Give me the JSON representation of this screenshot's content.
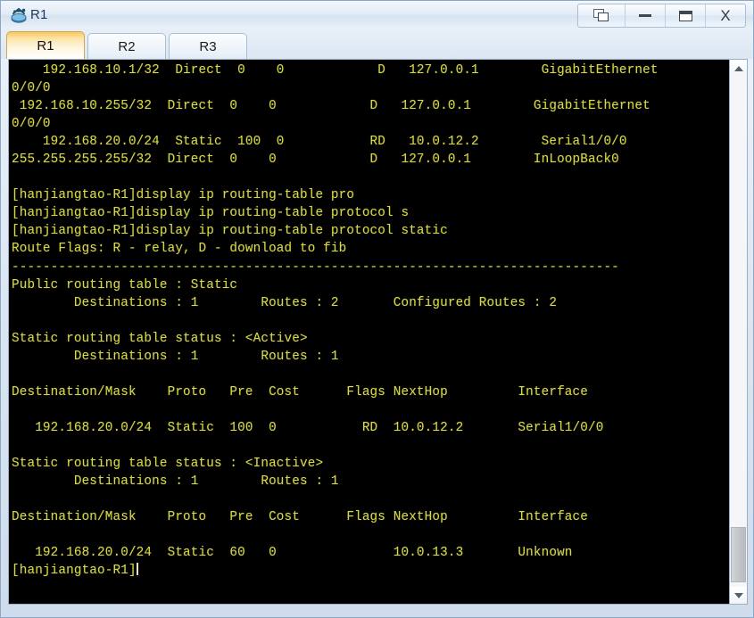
{
  "window": {
    "title": "R1",
    "icon": "router-icon",
    "buttons": [
      {
        "name": "restore-button",
        "label": "Restore",
        "glyph": "restore-icon"
      },
      {
        "name": "minimize-button",
        "label": "Minimize",
        "glyph": "minimize-icon"
      },
      {
        "name": "maximize-button",
        "label": "Maximize",
        "glyph": "maximize-icon"
      },
      {
        "name": "close-button",
        "label": "X",
        "glyph": "close-icon"
      }
    ]
  },
  "tabs": [
    {
      "label": "R1",
      "active": true
    },
    {
      "label": "R2",
      "active": false
    },
    {
      "label": "R3",
      "active": false
    }
  ],
  "terminal": {
    "prompt": "[hanjiangtao-R1]",
    "cursor_visible": true,
    "text_color": "#d7d74a",
    "background_color": "#000000",
    "lines": [
      "    192.168.10.1/32  Direct  0    0            D   127.0.0.1        GigabitEthernet",
      "0/0/0",
      " 192.168.10.255/32  Direct  0    0            D   127.0.0.1        GigabitEthernet",
      "0/0/0",
      "    192.168.20.0/24  Static  100  0           RD   10.0.12.2        Serial1/0/0",
      "255.255.255.255/32  Direct  0    0            D   127.0.0.1        InLoopBack0",
      "",
      "[hanjiangtao-R1]display ip routing-table pro",
      "[hanjiangtao-R1]display ip routing-table protocol s",
      "[hanjiangtao-R1]display ip routing-table protocol static",
      "Route Flags: R - relay, D - download to fib",
      "------------------------------------------------------------------------------",
      "Public routing table : Static",
      "        Destinations : 1        Routes : 2       Configured Routes : 2",
      "",
      "Static routing table status : <Active>",
      "        Destinations : 1        Routes : 1",
      "",
      "Destination/Mask    Proto   Pre  Cost      Flags NextHop         Interface",
      "",
      "   192.168.20.0/24  Static  100  0           RD  10.0.12.2       Serial1/0/0",
      "",
      "Static routing table status : <Inactive>",
      "        Destinations : 1        Routes : 1",
      "",
      "Destination/Mask    Proto   Pre  Cost      Flags NextHop         Interface",
      "",
      "   192.168.20.0/24  Static  60   0               10.0.13.3       Unknown",
      ""
    ]
  },
  "scrollbar": {
    "up_arrow": "scroll-up-icon",
    "down_arrow": "scroll-down-icon",
    "thumb_position": "bottom"
  },
  "routing_data": {
    "route_flags_legend": "Route Flags: R - relay, D - download to fib",
    "public_table": {
      "name": "Public routing table : Static",
      "destinations": "1",
      "routes": "2",
      "configured_routes": "2"
    },
    "tables": [
      {
        "status": "<Active>",
        "destinations": "1",
        "routes": "1",
        "columns": [
          "Destination/Mask",
          "Proto",
          "Pre",
          "Cost",
          "Flags",
          "NextHop",
          "Interface"
        ],
        "rows": [
          [
            "192.168.20.0/24",
            "Static",
            "100",
            "0",
            "RD",
            "10.0.12.2",
            "Serial1/0/0"
          ]
        ]
      },
      {
        "status": "<Inactive>",
        "destinations": "1",
        "routes": "1",
        "columns": [
          "Destination/Mask",
          "Proto",
          "Pre",
          "Cost",
          "Flags",
          "NextHop",
          "Interface"
        ],
        "rows": [
          [
            "192.168.20.0/24",
            "Static",
            "60",
            "0",
            "",
            "10.0.13.3",
            "Unknown"
          ]
        ]
      }
    ],
    "scrollback_rows": [
      [
        "192.168.10.1/32",
        "Direct",
        "0",
        "0",
        "D",
        "127.0.0.1",
        "GigabitEthernet0/0/0"
      ],
      [
        "192.168.10.255/32",
        "Direct",
        "0",
        "0",
        "D",
        "127.0.0.1",
        "GigabitEthernet0/0/0"
      ],
      [
        "192.168.20.0/24",
        "Static",
        "100",
        "0",
        "RD",
        "10.0.12.2",
        "Serial1/0/0"
      ],
      [
        "255.255.255.255/32",
        "Direct",
        "0",
        "0",
        "D",
        "127.0.0.1",
        "InLoopBack0"
      ]
    ],
    "commands": [
      "display ip routing-table pro",
      "display ip routing-table protocol s",
      "display ip routing-table protocol static"
    ]
  }
}
